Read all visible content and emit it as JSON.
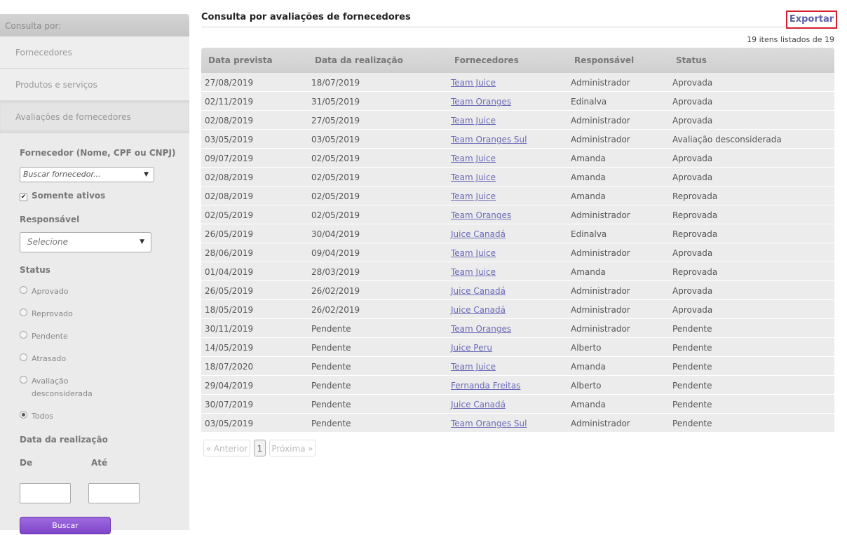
{
  "sidebar": {
    "header": "Consulta por:",
    "items": [
      {
        "label": "Fornecedores"
      },
      {
        "label": "Produtos e serviços"
      },
      {
        "label": "Avaliações de fornecedores"
      }
    ]
  },
  "filters": {
    "supplier_label": "Fornecedor (Nome, CPF ou CNPJ)",
    "supplier_placeholder": "Buscar fornecedor...",
    "only_active_label": "Somente ativos",
    "only_active_checked": true,
    "responsible_label": "Responsável",
    "responsible_value": "Selecione",
    "status_label": "Status",
    "status_options": [
      {
        "label": "Aprovado",
        "checked": false
      },
      {
        "label": "Reprovado",
        "checked": false
      },
      {
        "label": "Pendente",
        "checked": false
      },
      {
        "label": "Atrasado",
        "checked": false
      },
      {
        "label": "Avaliação desconsiderada",
        "line1": "Avaliação",
        "line2": "desconsiderada",
        "checked": false
      },
      {
        "label": "Todos",
        "checked": true
      }
    ],
    "date_label": "Data da realização",
    "from_label": "De",
    "to_label": "Até",
    "search_button": "Buscar"
  },
  "main": {
    "title": "Consulta por avaliações de fornecedores",
    "export_button": "Exportar",
    "count_text": "19 itens listados de 19",
    "columns": [
      "Data prevista",
      "Data da realização",
      "Fornecedores",
      "Responsável",
      "Status"
    ],
    "rows": [
      [
        "27/08/2019",
        "18/07/2019",
        "Team Juice",
        "Administrador",
        "Aprovada"
      ],
      [
        "02/11/2019",
        "31/05/2019",
        "Team Oranges",
        "Edinalva",
        "Aprovada"
      ],
      [
        "02/08/2019",
        "27/05/2019",
        "Team Juice",
        "Administrador",
        "Aprovada"
      ],
      [
        "03/05/2019",
        "03/05/2019",
        "Team Oranges Sul",
        "Administrador",
        "Avaliação desconsiderada"
      ],
      [
        "09/07/2019",
        "02/05/2019",
        "Team Juice",
        "Amanda",
        "Aprovada"
      ],
      [
        "02/08/2019",
        "02/05/2019",
        "Team Juice",
        "Amanda",
        "Aprovada"
      ],
      [
        "02/08/2019",
        "02/05/2019",
        "Team Juice",
        "Amanda",
        "Reprovada"
      ],
      [
        "02/05/2019",
        "02/05/2019",
        "Team Oranges",
        "Administrador",
        "Reprovada"
      ],
      [
        "26/05/2019",
        "30/04/2019",
        "Juice Canadá",
        "Edinalva",
        "Reprovada"
      ],
      [
        "28/06/2019",
        "09/04/2019",
        "Team Juice",
        "Administrador",
        "Aprovada"
      ],
      [
        "01/04/2019",
        "28/03/2019",
        "Team Juice",
        "Amanda",
        "Reprovada"
      ],
      [
        "26/05/2019",
        "26/02/2019",
        "Juice Canadá",
        "Administrador",
        "Aprovada"
      ],
      [
        "18/05/2019",
        "26/02/2019",
        "Juice Canadá",
        "Administrador",
        "Aprovada"
      ],
      [
        "30/11/2019",
        "Pendente",
        "Team Oranges",
        "Administrador",
        "Pendente"
      ],
      [
        "14/05/2019",
        "Pendente",
        "Juice Peru",
        "Alberto",
        "Pendente"
      ],
      [
        "18/07/2020",
        "Pendente",
        "Team Juice",
        "Amanda",
        "Pendente"
      ],
      [
        "29/04/2019",
        "Pendente",
        "Fernanda Freitas",
        "Alberto",
        "Pendente"
      ],
      [
        "30/07/2019",
        "Pendente",
        "Juice Canadá",
        "Amanda",
        "Pendente"
      ],
      [
        "03/05/2019",
        "Pendente",
        "Team Oranges Sul",
        "Administrador",
        "Pendente"
      ]
    ],
    "pagination": {
      "prev": "« Anterior",
      "current": "1",
      "next": "Próxima »"
    }
  }
}
